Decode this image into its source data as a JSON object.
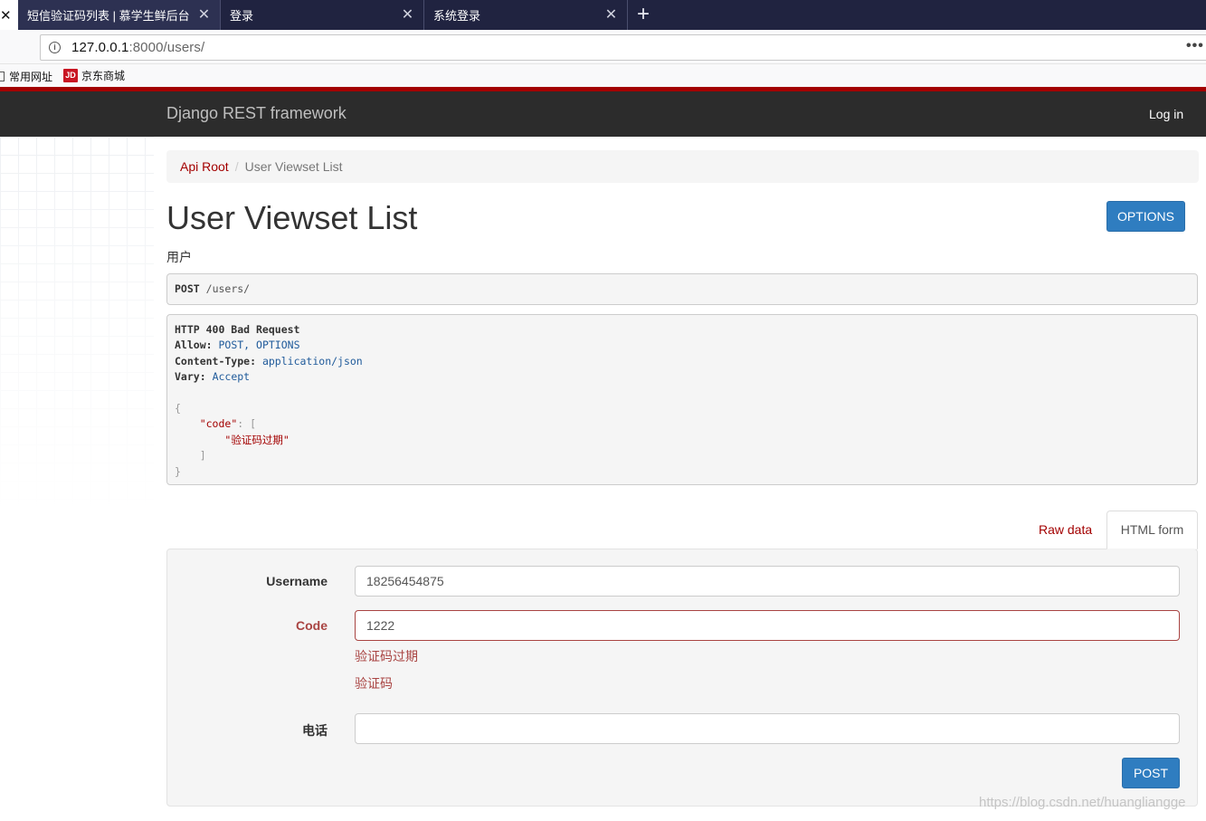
{
  "browser": {
    "tabs": [
      {
        "label": "短信验证码列表 | 慕学生鲜后台"
      },
      {
        "label": "登录"
      },
      {
        "label": "系统登录"
      }
    ],
    "close_glyph": "✕",
    "new_tab_glyph": "+",
    "url_host": "127.0.0.1",
    "url_rest": ":8000/users/",
    "info_glyph": "i",
    "more_glyph": "•••",
    "bookmarks": [
      {
        "label": "常用网址",
        "icon": "folder-icon"
      },
      {
        "label": "京东商城",
        "icon": "jd-icon",
        "icon_text": "JD"
      }
    ]
  },
  "navbar": {
    "brand": "Django REST framework",
    "login": "Log in"
  },
  "breadcrumb": {
    "root": "Api Root",
    "separator": "/",
    "current": "User Viewset List"
  },
  "page": {
    "title": "User Viewset List",
    "description": "用户",
    "options_label": "OPTIONS"
  },
  "request": {
    "method": "POST",
    "path": "/users/"
  },
  "response": {
    "status": "HTTP 400 Bad Request",
    "allow_key": "Allow:",
    "allow_value": "POST, OPTIONS",
    "ct_key": "Content-Type:",
    "ct_value": "application/json",
    "vary_key": "Vary:",
    "vary_value": "Accept",
    "open_brace": "{",
    "body_key": "\"code\"",
    "body_colon": ": [",
    "body_value": "\"验证码过期\"",
    "close_bracket": "]",
    "close_brace": "}"
  },
  "form_tabs": {
    "raw": "Raw data",
    "html": "HTML form"
  },
  "form": {
    "username_label": "Username",
    "username_value": "18256454875",
    "code_label": "Code",
    "code_value": "1222",
    "code_error": "验证码过期",
    "code_help": "验证码",
    "phone_label": "电话",
    "phone_value": "",
    "submit_label": "POST"
  },
  "watermark": "https://blog.csdn.net/huangliangge",
  "colors": {
    "accent_red": "#a30000",
    "nav_dark": "#2c2c2c",
    "button_blue": "#2f7dc0",
    "error": "#a94442"
  }
}
